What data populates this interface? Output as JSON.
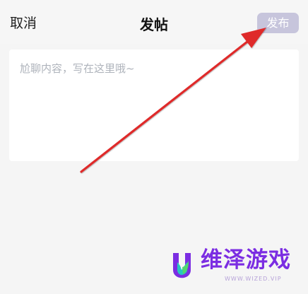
{
  "header": {
    "cancel_label": "取消",
    "title": "发帖",
    "publish_label": "发布"
  },
  "editor": {
    "placeholder": "尬聊内容，写在这里哦~",
    "value": ""
  },
  "watermark": {
    "brand": "维泽游戏",
    "url": "WWW.WIZED.VIP"
  },
  "colors": {
    "publish_button": "#c7c5dc",
    "annotation_arrow": "#df2b2b",
    "watermark_brand": "#7b2de2"
  }
}
